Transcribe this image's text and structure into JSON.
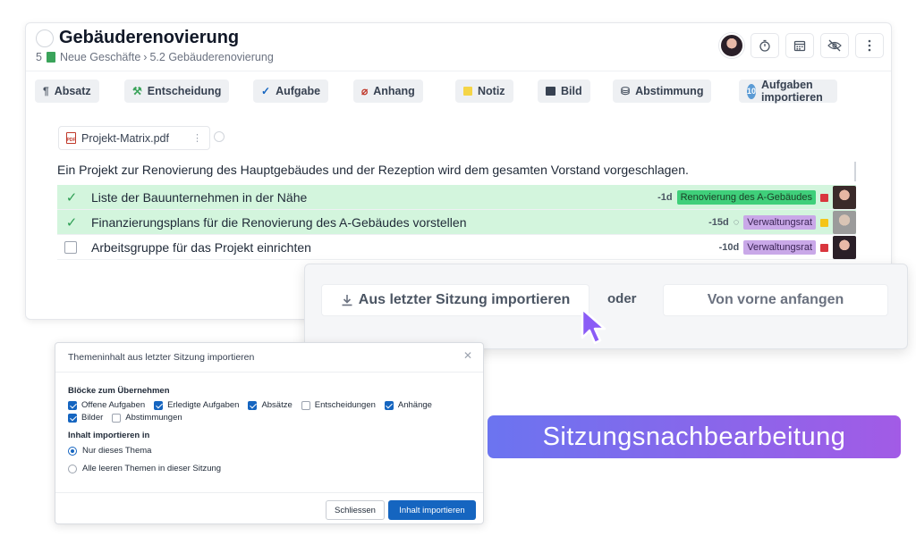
{
  "header": {
    "title": "Gebäuderenovierung",
    "breadcrumb_prefix": "5",
    "breadcrumb_section": "Neue Geschäfte",
    "breadcrumb_separator": "›",
    "breadcrumb_item": "5.2 Gebäuderenovierung"
  },
  "header_icons": [
    "timer-icon",
    "calendar-icon",
    "hide-icon",
    "more-vertical-icon"
  ],
  "toolbar": {
    "absatz": "Absatz",
    "entscheidung": "Entscheidung",
    "aufgabe": "Aufgabe",
    "anhang": "Anhang",
    "notiz": "Notiz",
    "bild": "Bild",
    "abstimmung": "Abstimmung",
    "import_count": "10",
    "aufgaben_importieren": "Aufgaben importieren"
  },
  "attachment": {
    "filename": "Projekt-Matrix.pdf",
    "icon_text": "PDF"
  },
  "paragraph": "Ein Projekt zur Renovierung des Hauptgebäudes und der Rezeption wird dem gesamten Vorstand vorgeschlagen.",
  "tasks": [
    {
      "text": "Liste der Bauunternehmen in der Nähe",
      "done": true,
      "days": "-1d",
      "tag": "Renovierung des A-Gebäudes",
      "tag_color": "#3fcf7a",
      "priority_color": "#d9363e"
    },
    {
      "text": "Finanzierungsplans für die Renovierung des A-Gebäudes vorstellen",
      "done": true,
      "days": "-15d",
      "tag": "Verwaltungsrat",
      "tag_color": "#c9a8e8",
      "priority_color": "#f5c518",
      "has_comment": true
    },
    {
      "text": "Arbeitsgruppe für das Projekt einrichten",
      "done": false,
      "days": "-10d",
      "tag": "Verwaltungsrat",
      "tag_color": "#c9a8e8",
      "priority_color": "#d9363e"
    }
  ],
  "import_bar": {
    "import_label": "Aus letzter Sitzung importieren",
    "or_label": "oder",
    "fresh_label": "Von vorne anfangen"
  },
  "dialog": {
    "title": "Themeninhalt aus letzter Sitzung importieren",
    "blocks_heading": "Blöcke zum Übernehmen",
    "checkboxes": [
      {
        "label": "Offene Aufgaben",
        "checked": true
      },
      {
        "label": "Erledigte Aufgaben",
        "checked": true
      },
      {
        "label": "Absätze",
        "checked": true
      },
      {
        "label": "Entscheidungen",
        "checked": false
      },
      {
        "label": "Anhänge",
        "checked": true
      },
      {
        "label": "Bilder",
        "checked": true
      },
      {
        "label": "Abstimmungen",
        "checked": false
      }
    ],
    "import_into_heading": "Inhalt importieren in",
    "radio_this_topic": "Nur dieses Thema",
    "radio_all_empty": "Alle leeren Themen in dieser Sitzung",
    "close_button": "Schliessen",
    "import_button": "Inhalt importieren"
  },
  "banner": {
    "text": "Sitzungsnachbearbeitung"
  },
  "colors": {
    "accent_blue": "#1565c0",
    "banner_start": "#6b74f0",
    "banner_end": "#a25be6",
    "done_row": "#d3f5dd"
  }
}
